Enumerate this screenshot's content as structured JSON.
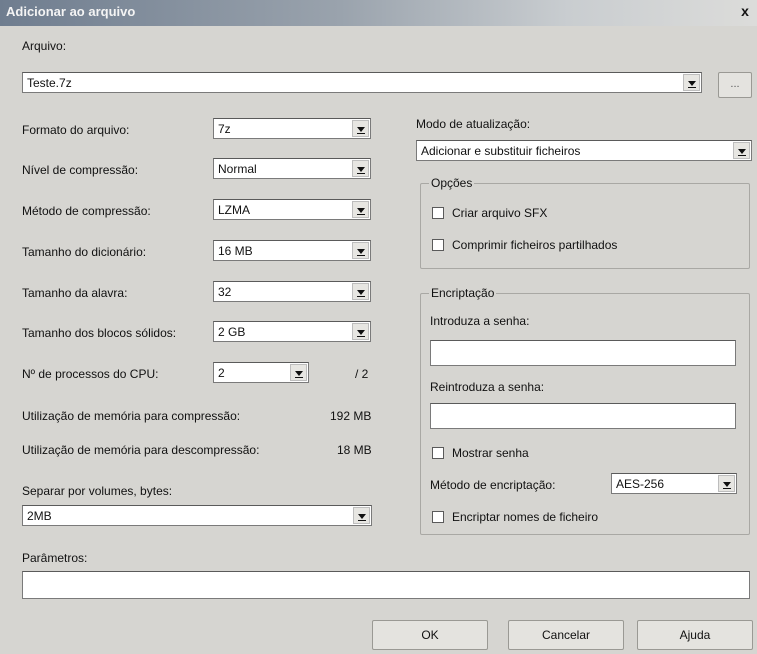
{
  "window": {
    "title": "Adicionar ao arquivo",
    "close": "x"
  },
  "archive": {
    "label": "Arquivo:",
    "value": "Teste.7z",
    "browse_label": "..."
  },
  "left": {
    "format": {
      "label": "Formato do arquivo:",
      "value": "7z"
    },
    "level": {
      "label": "Nível de compressão:",
      "value": "Normal"
    },
    "method": {
      "label": "Método de compressão:",
      "value": "LZMA"
    },
    "dict": {
      "label": "Tamanho do dicionário:",
      "value": "16 MB"
    },
    "word": {
      "label": "Tamanho da alavra:",
      "value": "32"
    },
    "solid": {
      "label": "Tamanho dos blocos sólidos:",
      "value": "2 GB"
    },
    "cpu": {
      "label": "Nº de processos do CPU:",
      "value": "2",
      "max": "/ 2"
    },
    "mem_comp": {
      "label": "Utilização de memória para compressão:",
      "value": "192 MB"
    },
    "mem_decomp": {
      "label": "Utilização de memória para descompressão:",
      "value": "18 MB"
    },
    "volumes": {
      "label": "Separar por volumes, bytes:",
      "value": "2MB"
    }
  },
  "right": {
    "update": {
      "label": "Modo de atualização:",
      "value": "Adicionar e substituir ficheiros"
    },
    "options": {
      "title": "Opções",
      "sfx": "Criar arquivo SFX",
      "shared": "Comprimir ficheiros partilhados"
    },
    "encryption": {
      "title": "Encriptação",
      "password_label": "Introduza a senha:",
      "repeat_label": "Reintroduza a senha:",
      "show": "Mostrar senha",
      "method_label": "Método de encriptação:",
      "method_value": "AES-256",
      "encrypt_names": "Encriptar nomes de ficheiro"
    }
  },
  "params": {
    "label": "Parâmetros:"
  },
  "buttons": {
    "ok": "OK",
    "cancel": "Cancelar",
    "help": "Ajuda"
  }
}
